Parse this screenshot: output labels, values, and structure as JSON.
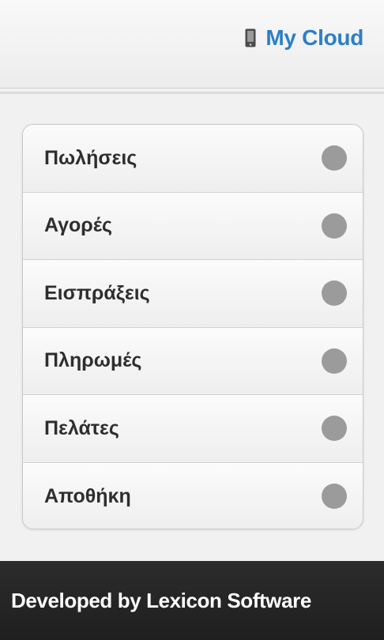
{
  "header": {
    "link_label": "My Cloud",
    "link_icon": "mobile-phone-icon",
    "link_color": "#2b7fc7"
  },
  "menu": {
    "items": [
      {
        "label": "Πωλήσεις",
        "icon": "circle-dot-icon"
      },
      {
        "label": "Αγορές",
        "icon": "circle-dot-icon"
      },
      {
        "label": "Εισπράξεις",
        "icon": "circle-dot-icon"
      },
      {
        "label": "Πληρωμές",
        "icon": "circle-dot-icon"
      },
      {
        "label": "Πελάτες",
        "icon": "circle-dot-icon"
      },
      {
        "label": "Αποθήκη",
        "icon": "circle-dot-icon"
      }
    ]
  },
  "footer": {
    "text": "Developed by Lexicon Software"
  }
}
